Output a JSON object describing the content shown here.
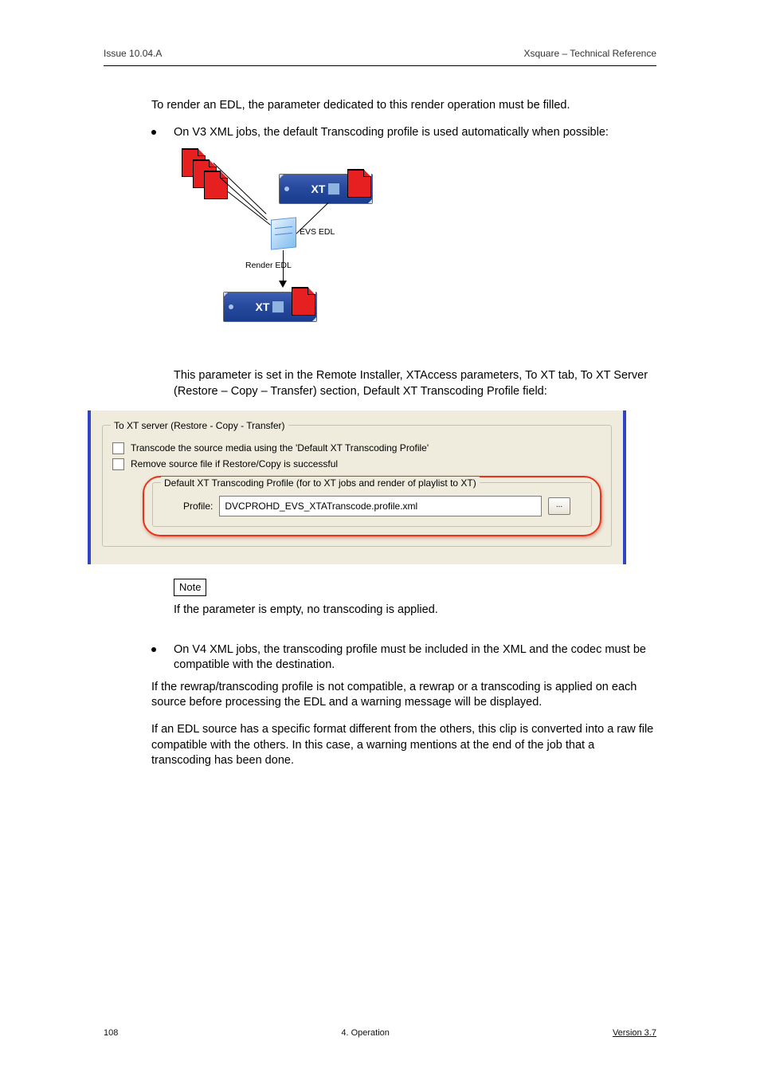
{
  "header": {
    "issue": "Issue 10.04.A",
    "product": "Xsquare – Technical Reference"
  },
  "body": {
    "p1": "To render an EDL, the parameter dedicated to this render operation must be filled.",
    "b1": "On V3 XML jobs, the default Transcoding profile is used automatically when possible:",
    "p2": "This parameter is set in the Remote Installer, XTAccess parameters, To XT tab, To XT Server (Restore – Copy – Transfer) section, Default XT Transcoding Profile field:",
    "note_label": "Note",
    "note_text": "If the parameter is empty, no transcoding is applied.",
    "b2": "On V4 XML jobs, the transcoding profile must be included in the XML and the codec must be compatible with the destination.",
    "p3": "If the rewrap/transcoding profile is not compatible, a rewrap or a transcoding is applied on each source before processing the EDL and a warning message will be displayed.",
    "p4": "If an EDL source has a specific format different from the others, this clip is converted into a raw file compatible with the others. In this case, a warning mentions at the end of the job that a transcoding has been done."
  },
  "diagram": {
    "xt_label": "XT",
    "edl_label": "EVS EDL",
    "render_label": "Render EDL"
  },
  "settings": {
    "group_title": "To XT server (Restore - Copy - Transfer)",
    "chk1": "Transcode the source media using the 'Default XT Transcoding Profile'",
    "chk2": "Remove source file if Restore/Copy is successful",
    "inner_group_title": "Default XT Transcoding Profile (for to XT jobs and render of playlist to XT)",
    "profile_label": "Profile:",
    "profile_value": "DVCPROHD_EVS_XTATranscode.profile.xml",
    "browse": "..."
  },
  "footer": {
    "page": "108",
    "section": "4. Operation",
    "version": "Version 3.7"
  }
}
